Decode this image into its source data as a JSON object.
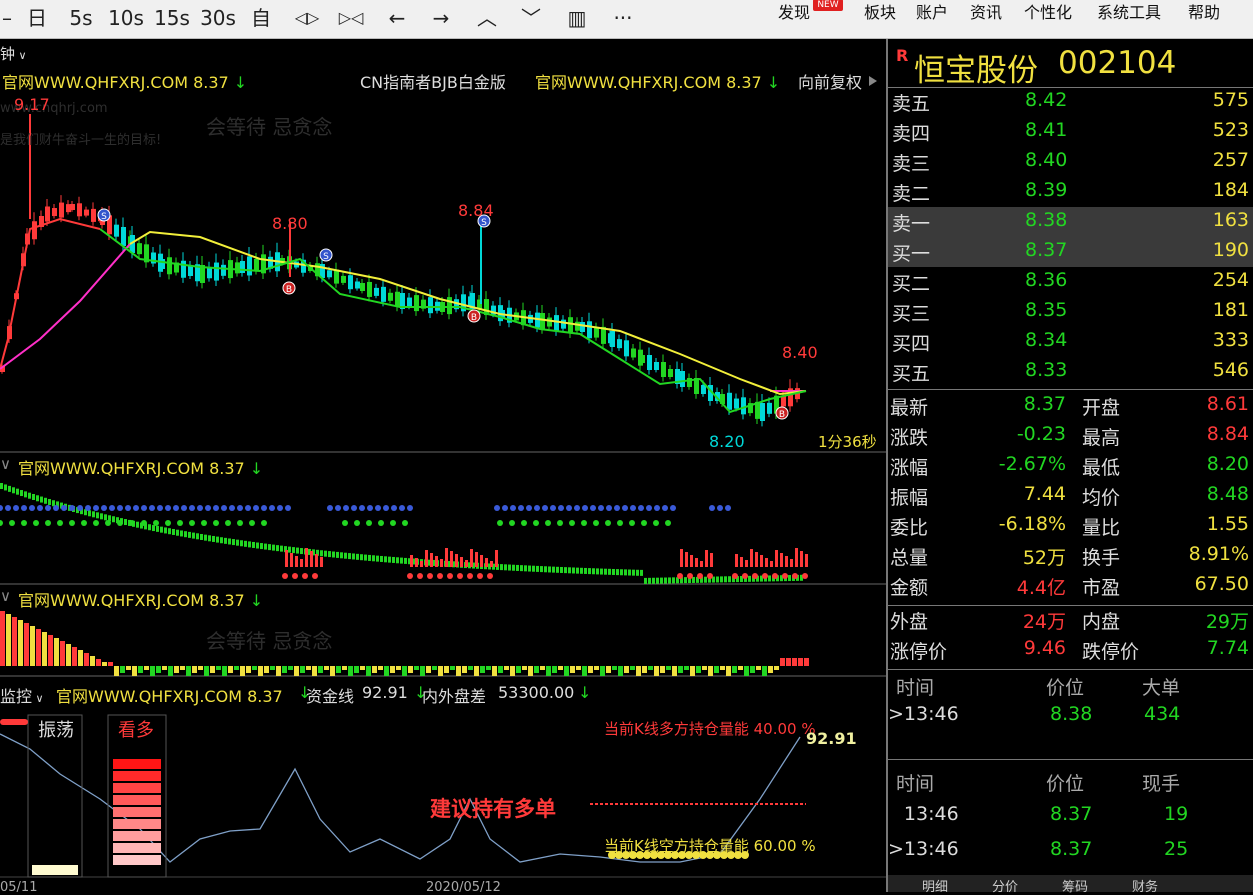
{
  "toolbar": {
    "buttons": [
      {
        "name": "minimize-icon",
        "label": "–"
      },
      {
        "name": "day-period-button",
        "label": "日"
      },
      {
        "name": "5s-period-button",
        "label": "5s"
      },
      {
        "name": "10s-period-button",
        "label": "10s"
      },
      {
        "name": "15s-period-button",
        "label": "15s"
      },
      {
        "name": "30s-period-button",
        "label": "30s"
      },
      {
        "name": "custom-period-button",
        "label": "自"
      },
      {
        "name": "zoom-out-icon",
        "label": "◁▷"
      },
      {
        "name": "zoom-in-icon",
        "label": "▷◁"
      },
      {
        "name": "arrow-left-icon",
        "label": "←"
      },
      {
        "name": "arrow-right-icon",
        "label": "→"
      },
      {
        "name": "chevron-up-icon",
        "label": "︿"
      },
      {
        "name": "chevron-down-icon",
        "label": "﹀"
      },
      {
        "name": "layout-icon",
        "label": "▥"
      },
      {
        "name": "more-icon",
        "label": "···"
      }
    ],
    "menus": [
      "发现",
      "板块",
      "账户",
      "资讯",
      "个性化",
      "系统工具",
      "帮助"
    ],
    "new_badge": "NEW"
  },
  "main_chart": {
    "period_label": "钟",
    "left_header": "官网WWW.QHFXRJ.COM 8.37",
    "center_header": "CN指南者BJB白金版",
    "right_header": "官网WWW.QHFXRJ.COM 8.37",
    "restore_label": "向前复权",
    "price_high_label": "9.17",
    "peak_labels": [
      "8.80",
      "8.84",
      "8.40"
    ],
    "low_label": "8.20",
    "timer": "1分36秒",
    "watermark_site": "www.cnqhrj.com",
    "watermark_text": "会等待 忌贪念",
    "watermark_slogan": "是我们财牛奋斗一生的目标!"
  },
  "subchart1": {
    "header": "官网WWW.QHFXRJ.COM 8.37"
  },
  "subchart2": {
    "header": "官网WWW.QHFXRJ.COM 8.37"
  },
  "subchart3": {
    "title": "监控",
    "site": "官网WWW.QHFXRJ.COM 8.37",
    "fund_label": "资金线",
    "fund_value": "92.91",
    "inout_label": "内外盘差",
    "inout_value": "53300.00",
    "state_label": "振荡",
    "view_label": "看多",
    "long_energy": "当前K线多方持仓量能 40.00 %",
    "short_energy": "当前K线空方持仓量能 60.00 %",
    "advice": "建议持有多单",
    "curve_value": "92.91",
    "date_left": "05/11",
    "date_mid": "2020/05/12"
  },
  "stock": {
    "badge": "R",
    "name": "恒宝股份",
    "code": "002104"
  },
  "order_book": {
    "asks": [
      {
        "label": "卖五",
        "price": "8.42",
        "vol": "575"
      },
      {
        "label": "卖四",
        "price": "8.41",
        "vol": "523"
      },
      {
        "label": "卖三",
        "price": "8.40",
        "vol": "257"
      },
      {
        "label": "卖二",
        "price": "8.39",
        "vol": "184"
      },
      {
        "label": "卖一",
        "price": "8.38",
        "vol": "163"
      }
    ],
    "bids": [
      {
        "label": "买一",
        "price": "8.37",
        "vol": "190"
      },
      {
        "label": "买二",
        "price": "8.36",
        "vol": "254"
      },
      {
        "label": "买三",
        "price": "8.35",
        "vol": "181"
      },
      {
        "label": "买四",
        "price": "8.34",
        "vol": "333"
      },
      {
        "label": "买五",
        "price": "8.33",
        "vol": "546"
      }
    ]
  },
  "quote": {
    "rows": [
      {
        "l1": "最新",
        "v1": "8.37",
        "c1": "#22d622",
        "l2": "开盘",
        "v2": "8.61",
        "c2": "#ff3a3a"
      },
      {
        "l1": "涨跌",
        "v1": "-0.23",
        "c1": "#22d622",
        "l2": "最高",
        "v2": "8.84",
        "c2": "#ff3a3a"
      },
      {
        "l1": "涨幅",
        "v1": "-2.67%",
        "c1": "#22d622",
        "l2": "最低",
        "v2": "8.20",
        "c2": "#22d622"
      },
      {
        "l1": "振幅",
        "v1": "7.44",
        "c1": "#f0e040",
        "l2": "均价",
        "v2": "8.48",
        "c2": "#22d622"
      },
      {
        "l1": "委比",
        "v1": "-6.18%",
        "c1": "#f0e040",
        "l2": "量比",
        "v2": "1.55",
        "c2": "#f0e040"
      },
      {
        "l1": "总量",
        "v1": "52万",
        "c1": "#f0e040",
        "l2": "换手",
        "v2": "8.91%",
        "c2": "#f0e040"
      },
      {
        "l1": "金额",
        "v1": "4.4亿",
        "c1": "#ff3a3a",
        "l2": "市盈",
        "v2": "67.50",
        "c2": "#f0e040"
      }
    ],
    "outer_label": "外盘",
    "outer_value": "24万",
    "inner_label": "内盘",
    "inner_value": "29万",
    "limit_up_label": "涨停价",
    "limit_up_value": "9.46",
    "limit_down_label": "跌停价",
    "limit_down_value": "7.74"
  },
  "big_orders": {
    "headers": [
      "时间",
      "价位",
      "大单"
    ],
    "rows": [
      {
        "time": "13:46",
        "price": "8.38",
        "vol": "434"
      }
    ]
  },
  "ticks": {
    "headers": [
      "时间",
      "价位",
      "现手"
    ],
    "rows": [
      {
        "time": "13:46",
        "price": "8.37",
        "vol": "19"
      },
      {
        "time": "13:46",
        "price": "8.37",
        "vol": "25"
      }
    ]
  },
  "bottom_tabs": [
    "明细",
    "分价",
    "筹码",
    "财务"
  ],
  "colors": {
    "up": "#ff3a3a",
    "down": "#22d622",
    "cyan": "#00d8d8",
    "yellow": "#f0e040",
    "ma_yellow": "#f2ef3a",
    "magenta": "#ff2fc8",
    "bg": "#000000"
  }
}
